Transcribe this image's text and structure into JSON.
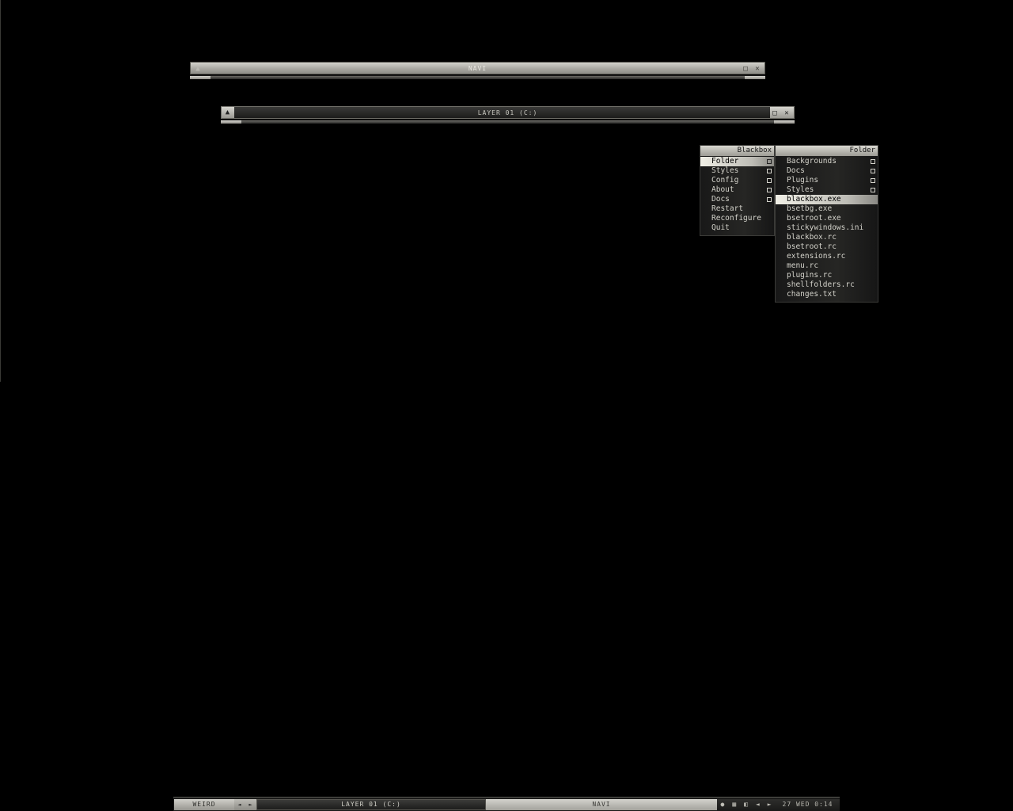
{
  "windows": {
    "navi": {
      "title": "NAVI"
    },
    "layer": {
      "title": "LAYER 01 (C:)"
    }
  },
  "icons": {
    "shade": "▲",
    "maximize": "□",
    "close": "✕",
    "arrow_left": "◄",
    "arrow_right": "►",
    "submenu": "square"
  },
  "menu_blackbox": {
    "title": "Blackbox",
    "items": [
      {
        "label": "Folder"
      },
      {
        "label": "Styles"
      },
      {
        "label": "Config"
      },
      {
        "label": "About"
      },
      {
        "label": "Docs"
      },
      {
        "label": "Restart"
      },
      {
        "label": "Reconfigure"
      },
      {
        "label": "Quit"
      }
    ]
  },
  "menu_folder": {
    "title": "Folder",
    "items": [
      {
        "label": "Backgrounds"
      },
      {
        "label": "Docs"
      },
      {
        "label": "Plugins"
      },
      {
        "label": "Styles"
      },
      {
        "label": "blackbox.exe"
      },
      {
        "label": "bsetbg.exe"
      },
      {
        "label": "bsetroot.exe"
      },
      {
        "label": "stickywindows.ini"
      },
      {
        "label": "blackbox.rc"
      },
      {
        "label": "bsetroot.rc"
      },
      {
        "label": "extensions.rc"
      },
      {
        "label": "menu.rc"
      },
      {
        "label": "plugins.rc"
      },
      {
        "label": "shellfolders.rc"
      },
      {
        "label": "changes.txt"
      }
    ]
  },
  "taskbar": {
    "workspace": "WEIRD",
    "tasks": [
      "LAYER 01 (C:)",
      "NAVI"
    ],
    "clock": "27 WED 0:14"
  },
  "colors": {
    "desktop": "#000000",
    "highlight": "#f0efe6",
    "menu_text": "#d4d3cb"
  }
}
